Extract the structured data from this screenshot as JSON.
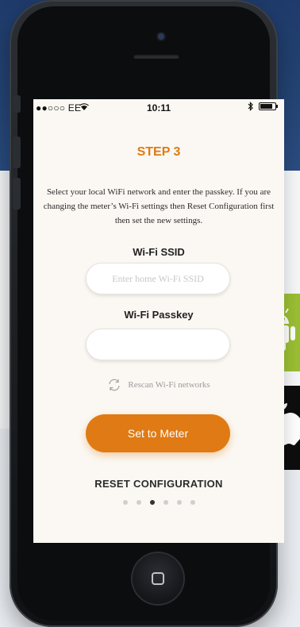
{
  "status_bar": {
    "carrier": "●●○○○ EE",
    "time": "10:11",
    "icons": [
      "wifi-icon",
      "bluetooth-icon",
      "battery-icon"
    ]
  },
  "screen": {
    "step_title": "STEP 3",
    "instructions": "Select your local WiFi network and enter the passkey. If you are changing the meter’s Wi-Fi settings then Reset Configuration first then set the new settings.",
    "ssid": {
      "label": "Wi-Fi SSID",
      "placeholder": "Enter home Wi-Fi SSID",
      "value": ""
    },
    "passkey": {
      "label": "Wi-Fi Passkey",
      "value": ""
    },
    "rescan_label": "Rescan Wi-Fi networks",
    "primary_button_label": "Set to Meter",
    "reset_label": "RESET CONFIGURATION",
    "pagination": {
      "count": 6,
      "active_index": 2
    }
  },
  "colors": {
    "accent": "#e07a14",
    "background_top": "#244474",
    "screen_bg": "#fbf8f3",
    "android_green": "#9bbf33"
  }
}
